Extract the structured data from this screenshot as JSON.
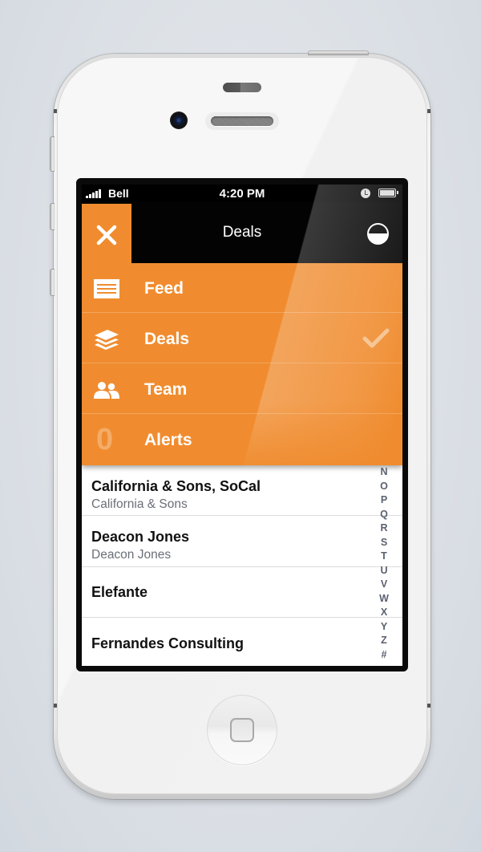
{
  "status_bar": {
    "carrier": "Bell",
    "time": "4:20 PM",
    "signal_bars": 5,
    "icons": [
      "signal-icon",
      "alarm-icon",
      "battery-icon"
    ]
  },
  "nav": {
    "title": "Deals",
    "left_icon": "close-icon",
    "right_icon": "half-circle-icon"
  },
  "menu": {
    "accent_color": "#f08c2f",
    "items": [
      {
        "label": "Feed",
        "icon": "feed-list-icon",
        "selected": false
      },
      {
        "label": "Deals",
        "icon": "stack-layers-icon",
        "selected": true
      },
      {
        "label": "Team",
        "icon": "team-people-icon",
        "selected": false
      },
      {
        "label": "Alerts",
        "icon": "alerts-count",
        "count": "0",
        "selected": false
      }
    ]
  },
  "list": {
    "rows": [
      {
        "title": "California & Sons, SoCal",
        "subtitle": "California & Sons"
      },
      {
        "title": "Deacon Jones",
        "subtitle": "Deacon Jones"
      },
      {
        "title": "Elefante",
        "subtitle": ""
      },
      {
        "title": "Fernandes Consulting",
        "subtitle": ""
      }
    ],
    "index_letters": [
      "N",
      "O",
      "P",
      "Q",
      "R",
      "S",
      "T",
      "U",
      "V",
      "W",
      "X",
      "Y",
      "Z",
      "#"
    ]
  }
}
